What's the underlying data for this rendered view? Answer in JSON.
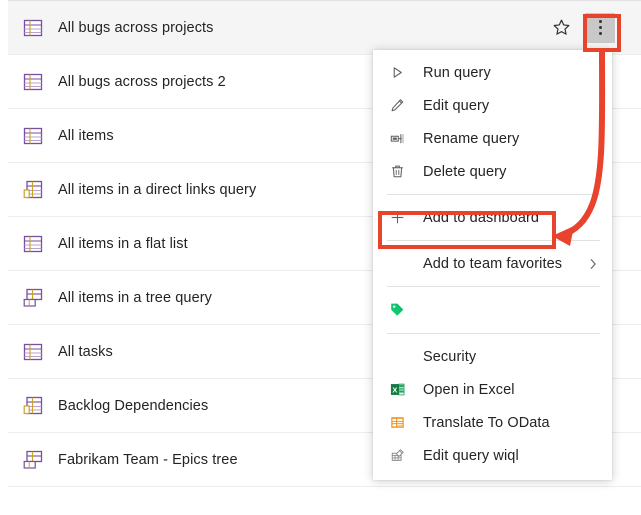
{
  "colors": {
    "callout_red": "#e8432c",
    "row_selected_bg": "#f5f5f5",
    "text": "#242424",
    "excel_green": "#107c41",
    "odata_orange": "#f2890c",
    "tag_green": "#10c96f",
    "kebab_bg": "#c8c8c8",
    "separator": "#ededed"
  },
  "query_list": {
    "rows": [
      {
        "label": "All bugs across projects",
        "icon": "flat-query-icon",
        "selected": true,
        "show_actions": true
      },
      {
        "label": "All bugs across projects 2",
        "icon": "flat-query-icon",
        "selected": false,
        "show_actions": false
      },
      {
        "label": "All items",
        "icon": "flat-query-icon",
        "selected": false,
        "show_actions": false
      },
      {
        "label": "All items in a direct links query",
        "icon": "direct-links-query-icon",
        "selected": false,
        "show_actions": false
      },
      {
        "label": "All items in a flat list",
        "icon": "flat-query-icon",
        "selected": false,
        "show_actions": false
      },
      {
        "label": "All items in a tree query",
        "icon": "tree-query-icon",
        "selected": false,
        "show_actions": false
      },
      {
        "label": "All tasks",
        "icon": "flat-query-icon",
        "selected": false,
        "show_actions": false
      },
      {
        "label": "Backlog Dependencies",
        "icon": "direct-links-query-icon",
        "selected": false,
        "show_actions": false
      },
      {
        "label": "Fabrikam Team - Epics tree",
        "icon": "tree-query-icon",
        "selected": false,
        "show_actions": false
      }
    ],
    "row_actions": {
      "favorite_icon": "star-outline-icon",
      "more_icon": "kebab-menu-icon"
    }
  },
  "context_menu": {
    "items": [
      {
        "label": "Run query",
        "icon": "play-icon",
        "type": "item"
      },
      {
        "label": "Edit query",
        "icon": "pencil-icon",
        "type": "item"
      },
      {
        "label": "Rename query",
        "icon": "rename-icon",
        "type": "item"
      },
      {
        "label": "Delete query",
        "icon": "trash-icon",
        "type": "item"
      },
      {
        "type": "separator"
      },
      {
        "label": "Add to dashboard",
        "icon": "plus-icon",
        "type": "item",
        "highlighted": true
      },
      {
        "type": "separator"
      },
      {
        "label": "Add to team favorites",
        "icon": "none",
        "type": "submenu",
        "chevron": "chevron-right-icon"
      },
      {
        "type": "separator"
      },
      {
        "label": "",
        "icon": "tag-icon",
        "type": "item"
      },
      {
        "type": "separator"
      },
      {
        "label": "Security",
        "icon": "none",
        "type": "item"
      },
      {
        "label": "Open in Excel",
        "icon": "excel-icon",
        "type": "item"
      },
      {
        "label": "Translate To OData",
        "icon": "odata-icon",
        "type": "item"
      },
      {
        "label": "Edit query wiql",
        "icon": "edit-wiql-icon",
        "type": "item"
      }
    ]
  },
  "annotations": {
    "kebab_callout": "red-rectangle-around-more-button",
    "dashboard_callout": "red-rectangle-around-add-to-dashboard",
    "arrow": "red-curved-arrow-from-more-button-to-add-to-dashboard"
  }
}
